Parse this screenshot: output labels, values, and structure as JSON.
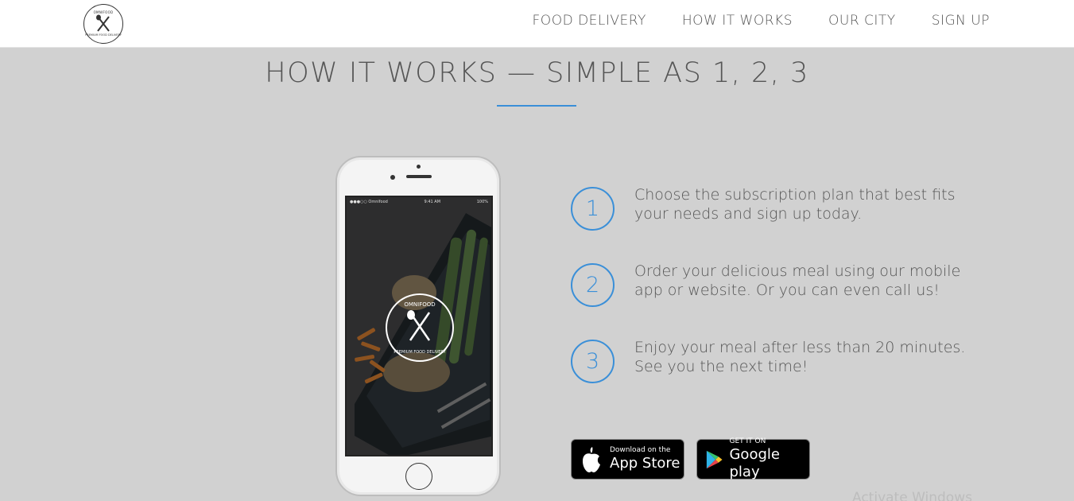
{
  "header": {
    "logo": {
      "top_text": "OMNIFOOD",
      "bottom_text": "PREMIUM FOOD DELIVERY"
    },
    "nav": [
      "FOOD DELIVERY",
      "HOW IT WORKS",
      "OUR CITY",
      "SIGN UP"
    ]
  },
  "section": {
    "title": "HOW IT WORKS — SIMPLE AS 1, 2, 3",
    "accent_color": "#3a8fd8"
  },
  "phone": {
    "status_left": "●●●○○ Omnifood",
    "status_time": "9:41 AM",
    "status_right": "100%",
    "logo_top": "OMNIFOOD",
    "logo_bottom": "PREMIUM FOOD DELIVERY"
  },
  "steps": [
    {
      "number": "1",
      "text": "Choose the subscription plan that best fits your needs and sign up today."
    },
    {
      "number": "2",
      "text": "Order your delicious meal using our mobile app or website. Or you can even call us!"
    },
    {
      "number": "3",
      "text": "Enjoy your meal after less than 20 minutes. See you the next time!"
    }
  ],
  "badges": {
    "apple": {
      "line1": "Download on the",
      "line2": "App Store",
      "icon": "apple-icon"
    },
    "google": {
      "line1": "GET IT ON",
      "line2": "Google play",
      "icon": "google-play-icon"
    }
  },
  "watermark": "Activate Windows"
}
